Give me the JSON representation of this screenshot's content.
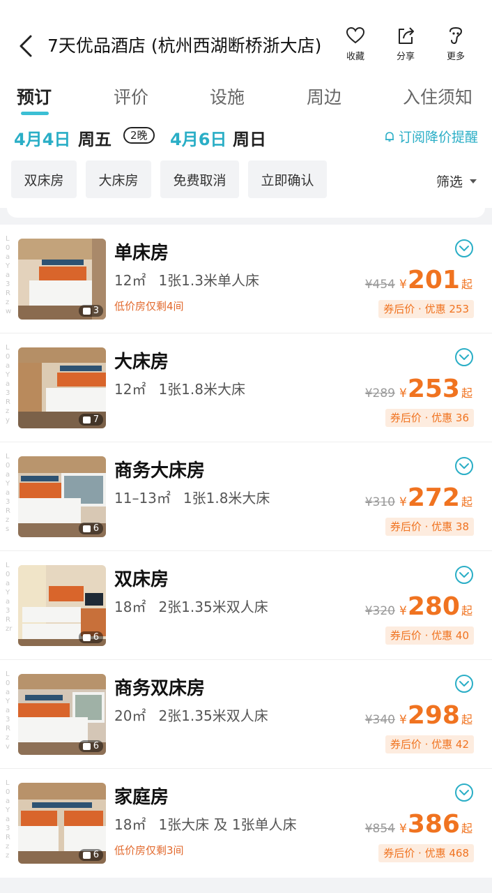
{
  "header": {
    "title": "7天优品酒店 (杭州西湖断桥浙大店)",
    "back_icon": "chevron-left-icon",
    "actions": [
      {
        "label": "收藏",
        "icon": "heart-icon"
      },
      {
        "label": "分享",
        "icon": "share-icon"
      },
      {
        "label": "更多",
        "icon": "more-icon"
      }
    ]
  },
  "tabs": [
    "预订",
    "评价",
    "设施",
    "周边",
    "入住须知"
  ],
  "active_tab": "预订",
  "dates": {
    "checkin_date": "4月4日",
    "checkin_day": "周五",
    "nights": "2晚",
    "checkout_date": "4月6日",
    "checkout_day": "周日",
    "subscribe": "订阅降价提醒"
  },
  "filters": [
    "双床房",
    "大床房",
    "免费取消",
    "立即确认"
  ],
  "filter_button": "筛选",
  "colors": {
    "accent": "#2aaec6",
    "price": "#f07320",
    "coupon_bg": "#fdecdf"
  },
  "rooms": [
    {
      "name": "单床房",
      "area": "12㎡",
      "bed": "1张1.3米单人床",
      "note": "低价房仅剩4间",
      "photos": "3",
      "original": "¥454",
      "currency": "¥",
      "price": "201",
      "suffix": "起",
      "coupon": "券后价 · 优惠 253",
      "watermark": "L0aYa3Rzw"
    },
    {
      "name": "大床房",
      "area": "12㎡",
      "bed": "1张1.8米大床",
      "note": "",
      "photos": "7",
      "original": "¥289",
      "currency": "¥",
      "price": "253",
      "suffix": "起",
      "coupon": "券后价 · 优惠 36",
      "watermark": "L0aYa3Rzy"
    },
    {
      "name": "商务大床房",
      "area": "11–13㎡",
      "bed": "1张1.8米大床",
      "note": "",
      "photos": "6",
      "original": "¥310",
      "currency": "¥",
      "price": "272",
      "suffix": "起",
      "coupon": "券后价 · 优惠 38",
      "watermark": "L0aYa3Rzs"
    },
    {
      "name": "双床房",
      "area": "18㎡",
      "bed": "2张1.35米双人床",
      "note": "",
      "photos": "6",
      "original": "¥320",
      "currency": "¥",
      "price": "280",
      "suffix": "起",
      "coupon": "券后价 · 优惠 40",
      "watermark": "L0aYa3Rzr"
    },
    {
      "name": "商务双床房",
      "area": "20㎡",
      "bed": "2张1.35米双人床",
      "note": "",
      "photos": "6",
      "original": "¥340",
      "currency": "¥",
      "price": "298",
      "suffix": "起",
      "coupon": "券后价 · 优惠 42",
      "watermark": "L0aYa3Rzv"
    },
    {
      "name": "家庭房",
      "area": "18㎡",
      "bed": "1张大床 及 1张单人床",
      "note": "低价房仅剩3间",
      "photos": "6",
      "original": "¥854",
      "currency": "¥",
      "price": "386",
      "suffix": "起",
      "coupon": "券后价 · 优惠 468",
      "watermark": "L0aYa3Rzz"
    }
  ]
}
